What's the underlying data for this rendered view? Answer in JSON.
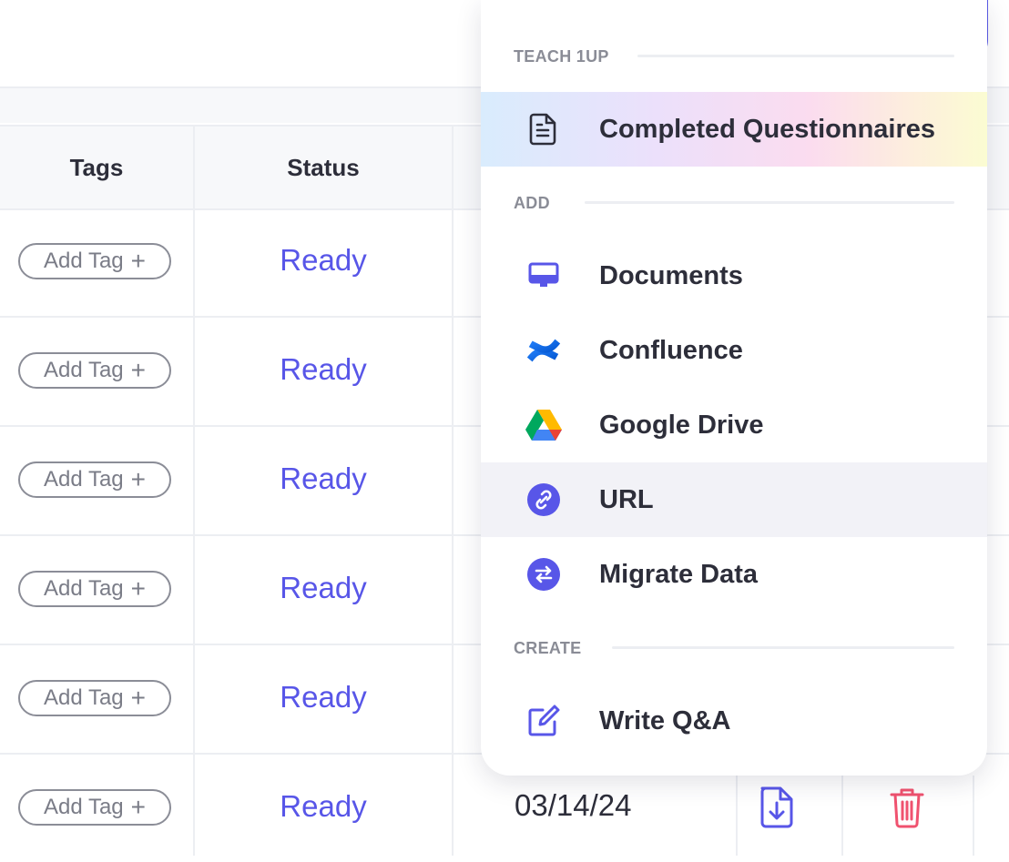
{
  "table": {
    "headers": {
      "tags": "Tags",
      "status": "Status"
    },
    "rows": [
      {
        "tag_label": "Add Tag",
        "tag_plus": "+",
        "status": "Ready"
      },
      {
        "tag_label": "Add Tag",
        "tag_plus": "+",
        "status": "Ready"
      },
      {
        "tag_label": "Add Tag",
        "tag_plus": "+",
        "status": "Ready"
      },
      {
        "tag_label": "Add Tag",
        "tag_plus": "+",
        "status": "Ready"
      },
      {
        "tag_label": "Add Tag",
        "tag_plus": "+",
        "status": "Ready"
      },
      {
        "tag_label": "Add Tag",
        "tag_plus": "+",
        "status": "Ready",
        "date": "03/14/24"
      }
    ]
  },
  "menu": {
    "sections": {
      "teach": "TEACH 1UP",
      "add": "ADD",
      "create": "CREATE"
    },
    "items": {
      "completed_questionnaires": {
        "label": "Completed Questionnaires",
        "icon": "document-icon"
      },
      "documents": {
        "label": "Documents",
        "icon": "monitor-icon"
      },
      "confluence": {
        "label": "Confluence",
        "icon": "confluence-icon"
      },
      "google_drive": {
        "label": "Google Drive",
        "icon": "google-drive-icon"
      },
      "url": {
        "label": "URL",
        "icon": "link-icon"
      },
      "migrate_data": {
        "label": "Migrate Data",
        "icon": "swap-icon"
      },
      "write_qa": {
        "label": "Write Q&A",
        "icon": "edit-icon"
      }
    }
  },
  "colors": {
    "accent": "#5856e8",
    "danger": "#f0526f",
    "text": "#2d2e3a",
    "muted": "#8a8c96"
  }
}
